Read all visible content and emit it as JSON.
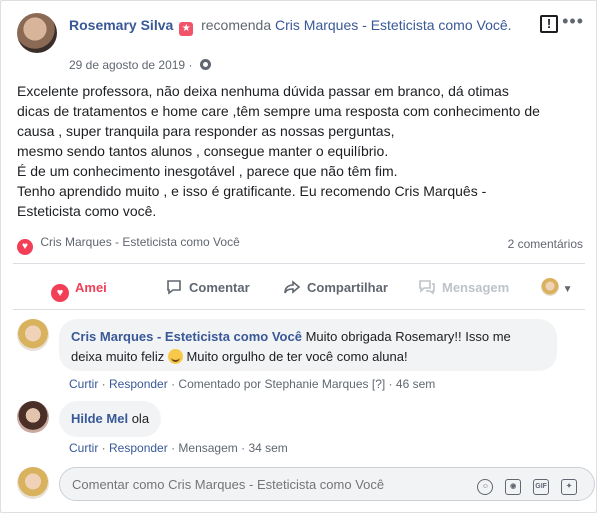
{
  "post": {
    "author": "Rosemary Silva",
    "action_text": "recomenda",
    "page_name": "Cris Marques - Esteticista como Você.",
    "date": "29 de agosto de 2019",
    "date_separator": "·",
    "review_lines": [
      "Excelente professora, não deixa nenhuma dúvida passar em branco, dá otimas",
      "dicas de tratamentos e home care ,têm sempre uma resposta com conhecimento de",
      "causa , super tranquila para responder as nossas perguntas,",
      "mesmo sendo tantos alunos , consegue manter o equilíbrio.",
      "É de um conhecimento inesgotável , parece que não têm fim.",
      "Tenho aprendido muito , e isso é gratificante. Eu recomendo Cris Marquês -",
      "Esteticista como você."
    ],
    "reacted_by": "Cris Marques - Esteticista como Você",
    "comments_count": "2 comentários"
  },
  "actions": {
    "like": "Amei",
    "comment": "Comentar",
    "share": "Compartilhar",
    "message": "Mensagem"
  },
  "comments": [
    {
      "name": "Cris Marques - Esteticista como Você",
      "text_1": "Muito obrigada Rosemary!! Isso me",
      "text_2": "deixa muito feliz",
      "text_3": "Muito orgulho de ter você como aluna!",
      "reply": "Curtir",
      "respond": "Responder",
      "commented_by": "Comentado por Stephanie Marques",
      "tag": "[?]",
      "time": "46 sem"
    },
    {
      "name": "Hilde Mel",
      "text": "ola",
      "reply": "Curtir",
      "respond": "Responder",
      "message": "Mensagem",
      "time": "34 sem"
    }
  ],
  "composer": {
    "placeholder": "Comentar como Cris Marques - Esteticista como Você",
    "icons": [
      "emoji-icon",
      "camera-icon",
      "gif-icon",
      "sticker-icon"
    ]
  },
  "colors": {
    "link": "#385898",
    "love": "#f33e58",
    "muted": "#616770"
  }
}
